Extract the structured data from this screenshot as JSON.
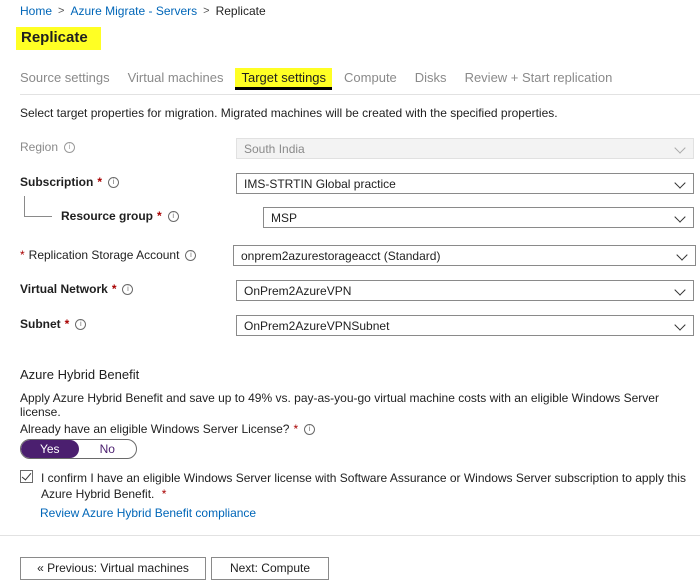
{
  "breadcrumb": {
    "items": [
      "Home",
      "Azure Migrate - Servers",
      "Replicate"
    ],
    "separator": ">"
  },
  "page": {
    "title": "Replicate",
    "highlight_color": "#ffff24"
  },
  "tabs": [
    {
      "label": "Source settings",
      "active": false
    },
    {
      "label": "Virtual machines",
      "active": false
    },
    {
      "label": "Target settings",
      "active": true
    },
    {
      "label": "Compute",
      "active": false
    },
    {
      "label": "Disks",
      "active": false
    },
    {
      "label": "Review + Start replication",
      "active": false
    }
  ],
  "description": "Select target properties for migration. Migrated machines will be created with the specified properties.",
  "form": {
    "region": {
      "label": "Region",
      "value": "South India",
      "disabled": true
    },
    "subscription": {
      "label": "Subscription",
      "required": "*",
      "value": "IMS-STRTIN Global practice"
    },
    "resource_group": {
      "label": "Resource group",
      "required": "*",
      "value": "MSP"
    },
    "storage_account": {
      "label": "Replication Storage Account",
      "required": "*",
      "value": "onprem2azurestorageacct (Standard)"
    },
    "virtual_network": {
      "label": "Virtual Network",
      "required": "*",
      "value": "OnPrem2AzureVPN"
    },
    "subnet": {
      "label": "Subnet",
      "required": "*",
      "value": "OnPrem2AzureVPNSubnet"
    }
  },
  "hybrid": {
    "title": "Azure Hybrid Benefit",
    "description": "Apply Azure Hybrid Benefit and save up to 49% vs. pay-as-you-go virtual machine costs with an eligible Windows Server license.",
    "question": "Already have an eligible Windows Server License?",
    "question_required": "*",
    "toggle": {
      "yes": "Yes",
      "no": "No",
      "selected": "Yes"
    },
    "confirm_text": "I confirm I have an eligible Windows Server license with Software Assurance  or Windows Server subscription to apply this Azure Hybrid Benefit.",
    "confirm_required": "*",
    "confirm_checked": true,
    "compliance_link": "Review Azure Hybrid Benefit compliance"
  },
  "footer": {
    "previous_label": "« Previous: Virtual machines",
    "next_label": "Next: Compute"
  },
  "colors": {
    "accent_purple": "#4b1f6f",
    "link_blue": "#0066b8",
    "required_red": "#a80000"
  },
  "icons": {
    "info": "info-icon",
    "dropdown": "chevron-down-icon",
    "check": "checkmark-icon"
  }
}
